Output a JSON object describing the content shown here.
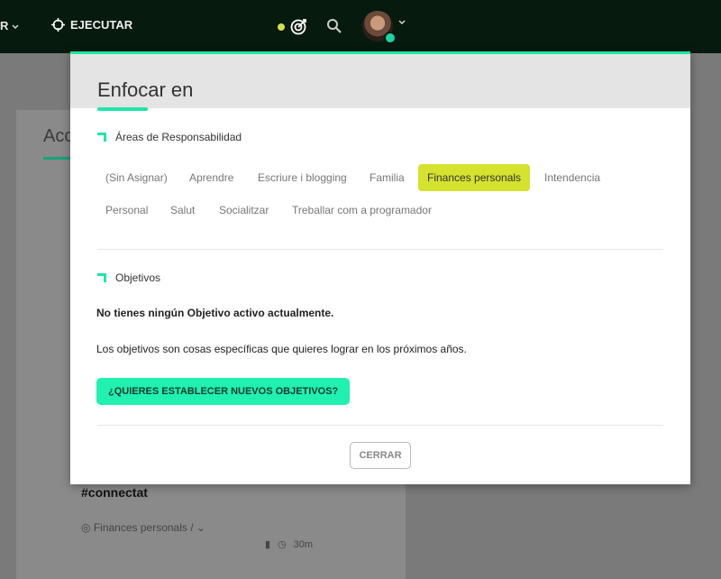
{
  "topbar": {
    "left_fragment": "R",
    "execute_label": "EJECUTAR"
  },
  "background": {
    "heading_fragment": "Acc",
    "card_title": "#connectat",
    "card_meta": "Finances personals /",
    "card_time": "30m"
  },
  "modal": {
    "title": "Enfocar en",
    "areas_label": "Áreas de Responsabilidad",
    "areas": [
      {
        "label": "(Sin Asignar)",
        "selected": false
      },
      {
        "label": "Aprendre",
        "selected": false
      },
      {
        "label": "Escriure i blogging",
        "selected": false
      },
      {
        "label": "Familia",
        "selected": false
      },
      {
        "label": "Finances personals",
        "selected": true
      },
      {
        "label": "Intendencia",
        "selected": false
      },
      {
        "label": "Personal",
        "selected": false
      },
      {
        "label": "Salut",
        "selected": false
      },
      {
        "label": "Socialitzar",
        "selected": false
      },
      {
        "label": "Treballar com a programador",
        "selected": false
      }
    ],
    "objectives_label": "Objetivos",
    "no_objectives": "No tienes ningún Objetivo activo actualmente.",
    "description": "Los objetivos son cosas específicas que quieres lograr en los próximos años.",
    "cta_label": "¿QUIERES ESTABLECER NUEVOS OBJETIVOS?",
    "close_label": "CERRAR"
  },
  "colors": {
    "accent": "#1ee6a8",
    "selected_chip": "#d5e22e",
    "topbar_bg": "#061a0e"
  }
}
